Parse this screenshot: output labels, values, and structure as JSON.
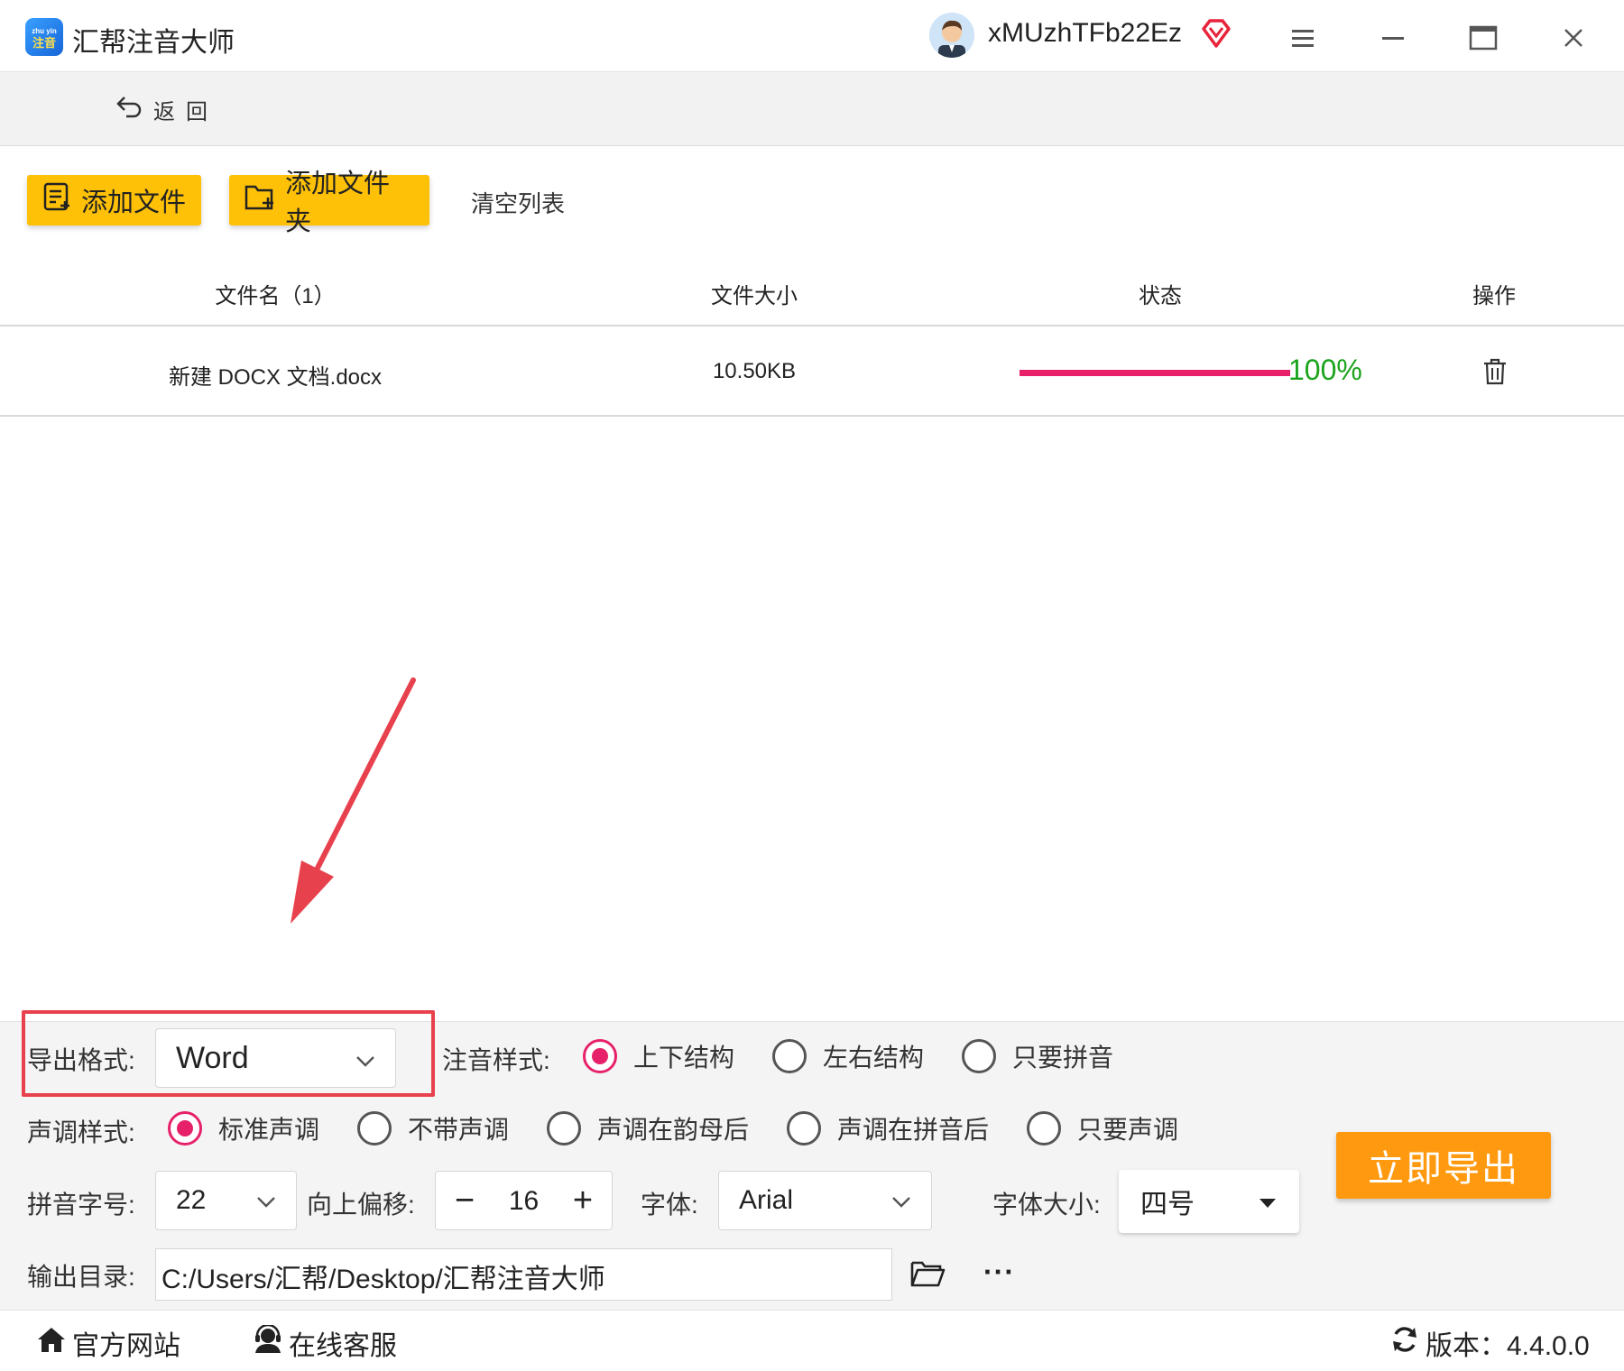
{
  "window": {
    "app_title": "汇帮注音大师",
    "logo_text": "注音",
    "logo_small": "zhu yin",
    "username": "xMUzhTFb22Ez",
    "icons": [
      "menu-icon",
      "minimize-icon",
      "maximize-icon",
      "close-icon"
    ]
  },
  "nav": {
    "back_label": "返回"
  },
  "toolbar": {
    "add_file": "添加文件",
    "add_folder": "添加文件夹",
    "clear_list": "清空列表"
  },
  "table": {
    "headers": {
      "name": "文件名（1）",
      "size": "文件大小",
      "status": "状态",
      "action": "操作"
    },
    "rows": [
      {
        "name": "新建 DOCX 文档.docx",
        "size": "10.50KB",
        "progress": 100,
        "progress_label": "100%"
      }
    ]
  },
  "settings": {
    "export_format_label": "导出格式:",
    "export_format_value": "Word",
    "annotation_style_label": "注音样式:",
    "annotation_options": [
      "上下结构",
      "左右结构",
      "只要拼音"
    ],
    "annotation_selected": "上下结构",
    "tone_style_label": "声调样式:",
    "tone_options": [
      "标准声调",
      "不带声调",
      "声调在韵母后",
      "声调在拼音后",
      "只要声调"
    ],
    "tone_selected": "标准声调",
    "pinyin_size_label": "拼音字号:",
    "pinyin_size_value": "22",
    "offset_label": "向上偏移:",
    "offset_value": "16",
    "font_label": "字体:",
    "font_value": "Arial",
    "font_size_label": "字体大小:",
    "font_size_value": "四号",
    "output_dir_label": "输出目录:",
    "output_dir_value": "C:/Users/汇帮/Desktop/汇帮注音大师",
    "export_button": "立即导出",
    "more_label": "···"
  },
  "footer": {
    "website": "官方网站",
    "support": "在线客服",
    "version": "版本：4.4.0.0"
  },
  "colors": {
    "accent_yellow": "#ffc107",
    "export_orange": "#ff9a10",
    "progress_pink": "#e6216a",
    "success_green": "#1aa31a",
    "annotation_red": "#e8414e"
  }
}
